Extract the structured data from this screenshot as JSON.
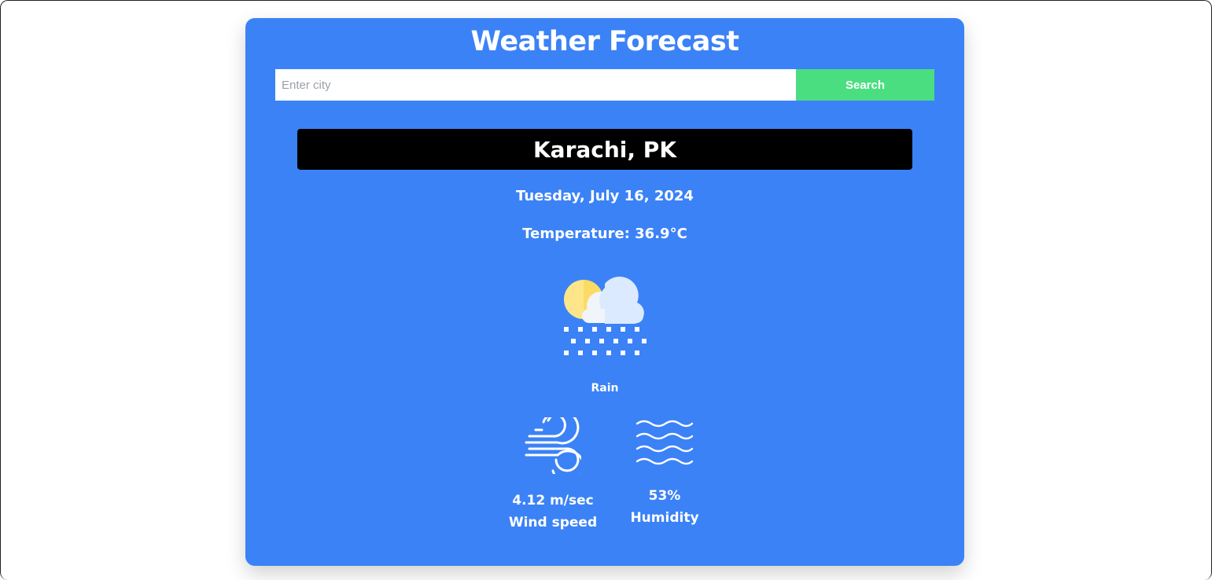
{
  "app": {
    "title": "Weather Forecast"
  },
  "search": {
    "placeholder": "Enter city",
    "value": "",
    "button_label": "Search"
  },
  "weather": {
    "location": "Karachi, PK",
    "date": "Tuesday, July 16, 2024",
    "temperature": "Temperature: 36.9°C",
    "condition": "Rain",
    "condition_icon": "sun-cloud-rain-icon",
    "wind": {
      "value": "4.12 m/sec",
      "label": "Wind speed",
      "icon": "wind-icon"
    },
    "humidity": {
      "value": "53%",
      "label": "Humidity",
      "icon": "humidity-waves-icon"
    }
  },
  "colors": {
    "card_background": "#3b82f6",
    "search_button": "#4ade80",
    "city_bar": "#000000",
    "text": "#ffffff"
  }
}
